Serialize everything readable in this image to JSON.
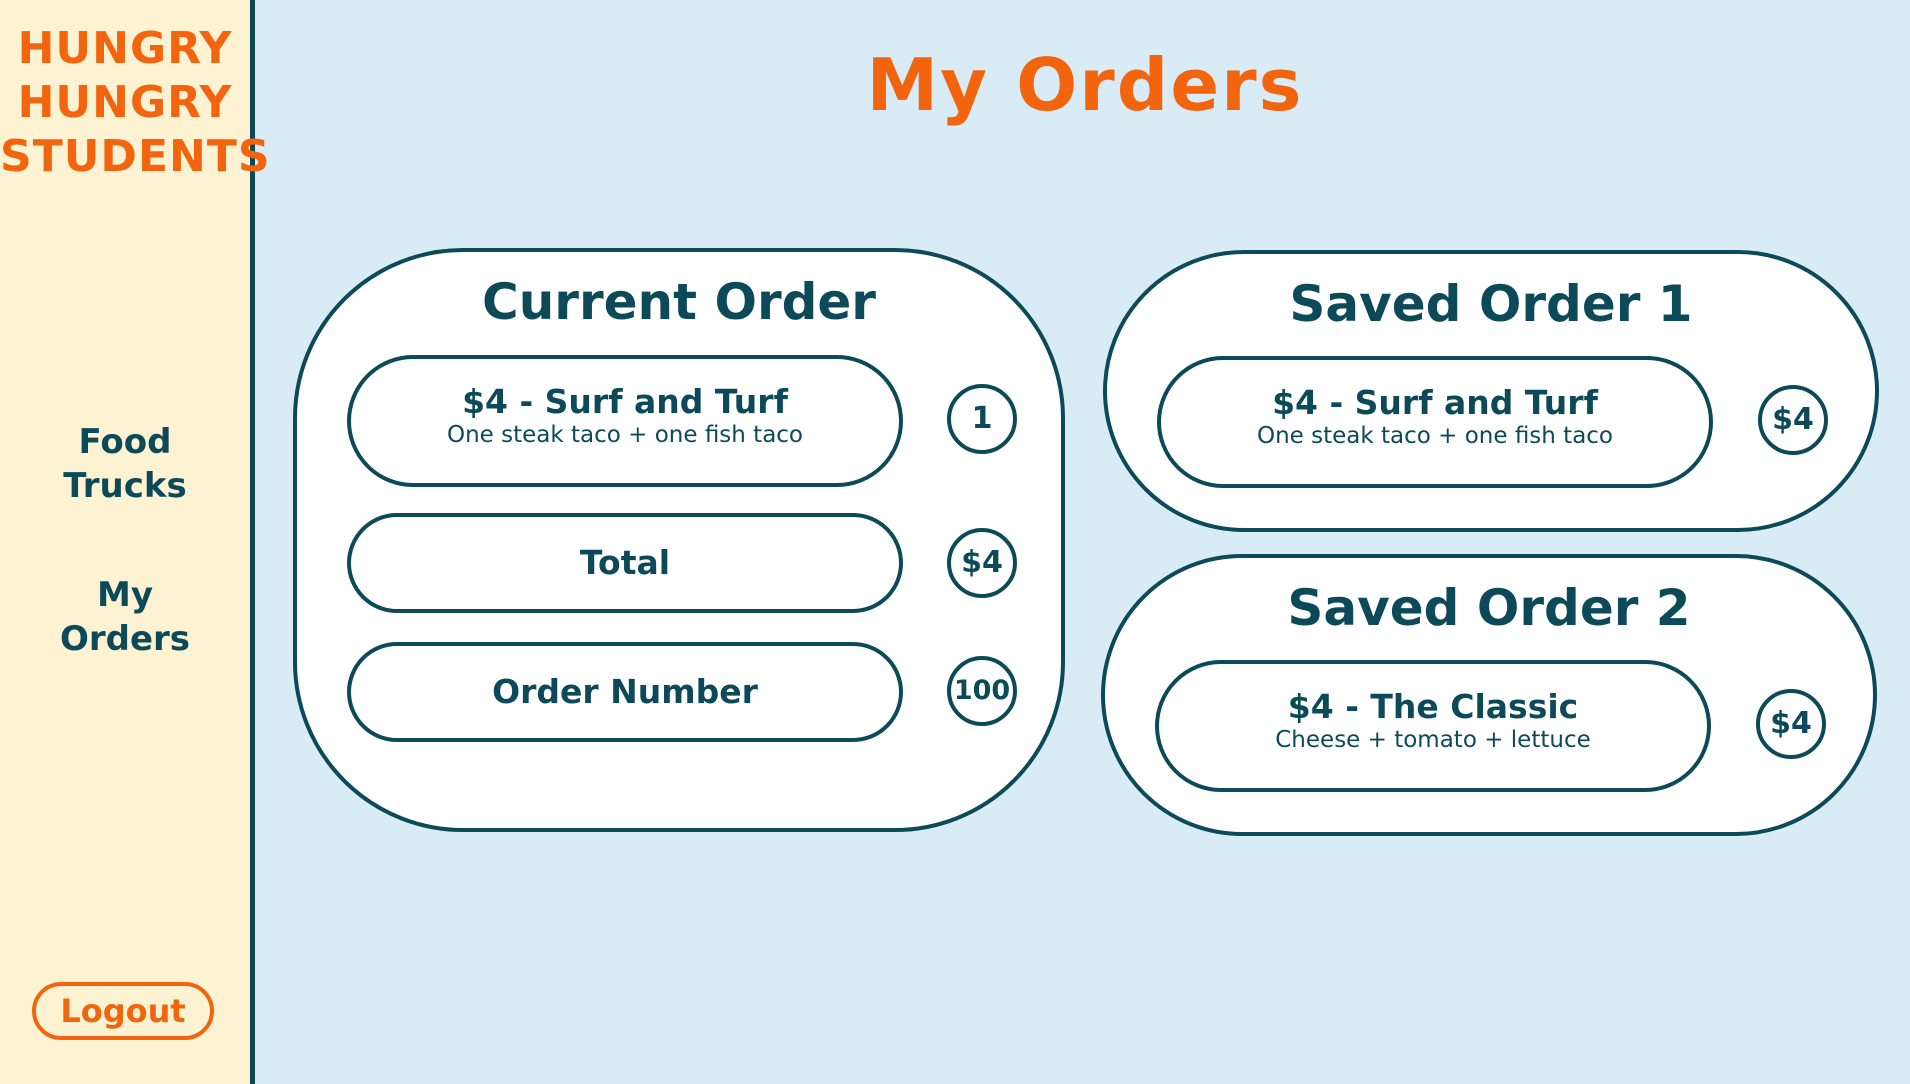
{
  "app": {
    "logo_lines": [
      "HUNGRY",
      "HUNGRY",
      "STUDENTS"
    ]
  },
  "sidebar": {
    "items": [
      {
        "lines": [
          "Food",
          "Trucks"
        ]
      },
      {
        "lines": [
          "My",
          "Orders"
        ]
      }
    ],
    "logout_label": "Logout"
  },
  "page": {
    "title": "My Orders"
  },
  "current_order": {
    "title": "Current Order",
    "item": {
      "name": "$4 - Surf and Turf",
      "description": "One steak taco + one fish taco",
      "quantity": "1"
    },
    "total": {
      "label": "Total",
      "value": "$4"
    },
    "order_number": {
      "label": "Order Number",
      "value": "100"
    }
  },
  "saved_orders": [
    {
      "title": "Saved Order 1",
      "item": {
        "name": "$4 - Surf and Turf",
        "description": "One steak taco + one fish taco",
        "price": "$4"
      }
    },
    {
      "title": "Saved Order 2",
      "item": {
        "name": "$4 - The Classic",
        "description": "Cheese + tomato + lettuce",
        "price": "$4"
      }
    }
  ],
  "colors": {
    "accent": "#f2650e",
    "primary": "#0c4a5a",
    "sidebar_bg": "#fdf3d2",
    "page_bg": "#d9ecf6"
  }
}
